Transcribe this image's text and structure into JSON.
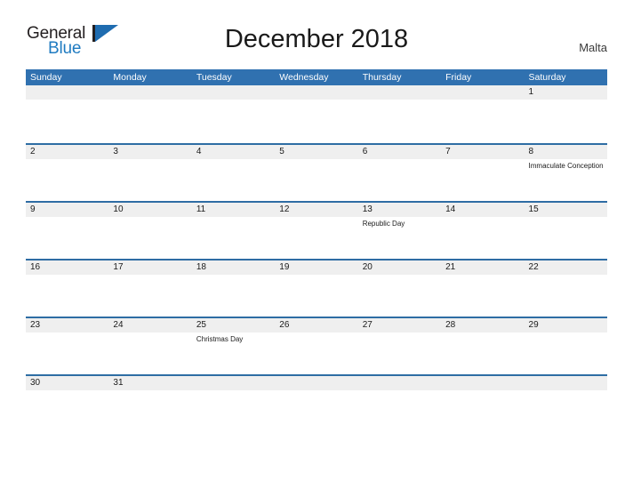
{
  "brand": {
    "word_one": "General",
    "word_two": "Blue",
    "flag_icon": "blue-triangle-flag-icon"
  },
  "header": {
    "title": "December 2018",
    "locale": "Malta"
  },
  "calendar": {
    "weekdays": [
      "Sunday",
      "Monday",
      "Tuesday",
      "Wednesday",
      "Thursday",
      "Friday",
      "Saturday"
    ],
    "colors": {
      "header_blue": "#3071b0",
      "row_divider_blue": "#2e6da4",
      "daynum_band_gray": "#efefef",
      "brand_blue": "#1f7bc1",
      "text_dark": "#1a1a1a"
    },
    "weeks": [
      {
        "days": [
          {
            "num": "",
            "event": ""
          },
          {
            "num": "",
            "event": ""
          },
          {
            "num": "",
            "event": ""
          },
          {
            "num": "",
            "event": ""
          },
          {
            "num": "",
            "event": ""
          },
          {
            "num": "",
            "event": ""
          },
          {
            "num": "1",
            "event": ""
          }
        ]
      },
      {
        "days": [
          {
            "num": "2",
            "event": ""
          },
          {
            "num": "3",
            "event": ""
          },
          {
            "num": "4",
            "event": ""
          },
          {
            "num": "5",
            "event": ""
          },
          {
            "num": "6",
            "event": ""
          },
          {
            "num": "7",
            "event": ""
          },
          {
            "num": "8",
            "event": "Immaculate Conception"
          }
        ]
      },
      {
        "days": [
          {
            "num": "9",
            "event": ""
          },
          {
            "num": "10",
            "event": ""
          },
          {
            "num": "11",
            "event": ""
          },
          {
            "num": "12",
            "event": ""
          },
          {
            "num": "13",
            "event": "Republic Day"
          },
          {
            "num": "14",
            "event": ""
          },
          {
            "num": "15",
            "event": ""
          }
        ]
      },
      {
        "days": [
          {
            "num": "16",
            "event": ""
          },
          {
            "num": "17",
            "event": ""
          },
          {
            "num": "18",
            "event": ""
          },
          {
            "num": "19",
            "event": ""
          },
          {
            "num": "20",
            "event": ""
          },
          {
            "num": "21",
            "event": ""
          },
          {
            "num": "22",
            "event": ""
          }
        ]
      },
      {
        "days": [
          {
            "num": "23",
            "event": ""
          },
          {
            "num": "24",
            "event": ""
          },
          {
            "num": "25",
            "event": "Christmas Day"
          },
          {
            "num": "26",
            "event": ""
          },
          {
            "num": "27",
            "event": ""
          },
          {
            "num": "28",
            "event": ""
          },
          {
            "num": "29",
            "event": ""
          }
        ]
      },
      {
        "short": true,
        "days": [
          {
            "num": "30",
            "event": ""
          },
          {
            "num": "31",
            "event": ""
          },
          {
            "num": "",
            "event": ""
          },
          {
            "num": "",
            "event": ""
          },
          {
            "num": "",
            "event": ""
          },
          {
            "num": "",
            "event": ""
          },
          {
            "num": "",
            "event": ""
          }
        ]
      }
    ]
  }
}
